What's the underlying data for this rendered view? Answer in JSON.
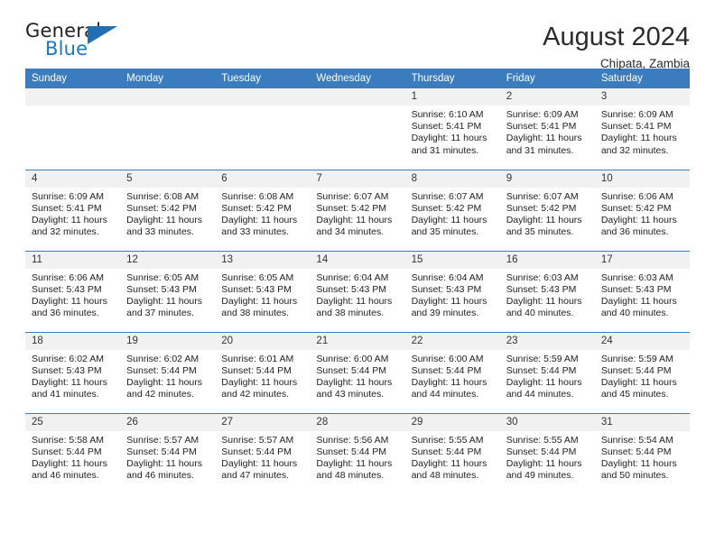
{
  "logo": {
    "word_top": "General",
    "word_bottom": "Blue",
    "triangle_color": "#1f6fb4",
    "blue_color": "#1a78c2"
  },
  "header": {
    "title": "August 2024",
    "subtitle": "Chipata, Zambia"
  },
  "theme": {
    "header_blue": "#3a7cbe",
    "daynum_band": "#f1f1f1",
    "text": "#212121"
  },
  "weekdays": [
    "Sunday",
    "Monday",
    "Tuesday",
    "Wednesday",
    "Thursday",
    "Friday",
    "Saturday"
  ],
  "weeks": [
    [
      {
        "day": "",
        "sunrise": "",
        "sunset": "",
        "daylight1": "",
        "daylight2": "",
        "empty": true
      },
      {
        "day": "",
        "sunrise": "",
        "sunset": "",
        "daylight1": "",
        "daylight2": "",
        "empty": true
      },
      {
        "day": "",
        "sunrise": "",
        "sunset": "",
        "daylight1": "",
        "daylight2": "",
        "empty": true
      },
      {
        "day": "",
        "sunrise": "",
        "sunset": "",
        "daylight1": "",
        "daylight2": "",
        "empty": true
      },
      {
        "day": "1",
        "sunrise": "Sunrise: 6:10 AM",
        "sunset": "Sunset: 5:41 PM",
        "daylight1": "Daylight: 11 hours",
        "daylight2": "and 31 minutes.",
        "empty": false
      },
      {
        "day": "2",
        "sunrise": "Sunrise: 6:09 AM",
        "sunset": "Sunset: 5:41 PM",
        "daylight1": "Daylight: 11 hours",
        "daylight2": "and 31 minutes.",
        "empty": false
      },
      {
        "day": "3",
        "sunrise": "Sunrise: 6:09 AM",
        "sunset": "Sunset: 5:41 PM",
        "daylight1": "Daylight: 11 hours",
        "daylight2": "and 32 minutes.",
        "empty": false
      }
    ],
    [
      {
        "day": "4",
        "sunrise": "Sunrise: 6:09 AM",
        "sunset": "Sunset: 5:41 PM",
        "daylight1": "Daylight: 11 hours",
        "daylight2": "and 32 minutes.",
        "empty": false
      },
      {
        "day": "5",
        "sunrise": "Sunrise: 6:08 AM",
        "sunset": "Sunset: 5:42 PM",
        "daylight1": "Daylight: 11 hours",
        "daylight2": "and 33 minutes.",
        "empty": false
      },
      {
        "day": "6",
        "sunrise": "Sunrise: 6:08 AM",
        "sunset": "Sunset: 5:42 PM",
        "daylight1": "Daylight: 11 hours",
        "daylight2": "and 33 minutes.",
        "empty": false
      },
      {
        "day": "7",
        "sunrise": "Sunrise: 6:07 AM",
        "sunset": "Sunset: 5:42 PM",
        "daylight1": "Daylight: 11 hours",
        "daylight2": "and 34 minutes.",
        "empty": false
      },
      {
        "day": "8",
        "sunrise": "Sunrise: 6:07 AM",
        "sunset": "Sunset: 5:42 PM",
        "daylight1": "Daylight: 11 hours",
        "daylight2": "and 35 minutes.",
        "empty": false
      },
      {
        "day": "9",
        "sunrise": "Sunrise: 6:07 AM",
        "sunset": "Sunset: 5:42 PM",
        "daylight1": "Daylight: 11 hours",
        "daylight2": "and 35 minutes.",
        "empty": false
      },
      {
        "day": "10",
        "sunrise": "Sunrise: 6:06 AM",
        "sunset": "Sunset: 5:42 PM",
        "daylight1": "Daylight: 11 hours",
        "daylight2": "and 36 minutes.",
        "empty": false
      }
    ],
    [
      {
        "day": "11",
        "sunrise": "Sunrise: 6:06 AM",
        "sunset": "Sunset: 5:43 PM",
        "daylight1": "Daylight: 11 hours",
        "daylight2": "and 36 minutes.",
        "empty": false
      },
      {
        "day": "12",
        "sunrise": "Sunrise: 6:05 AM",
        "sunset": "Sunset: 5:43 PM",
        "daylight1": "Daylight: 11 hours",
        "daylight2": "and 37 minutes.",
        "empty": false
      },
      {
        "day": "13",
        "sunrise": "Sunrise: 6:05 AM",
        "sunset": "Sunset: 5:43 PM",
        "daylight1": "Daylight: 11 hours",
        "daylight2": "and 38 minutes.",
        "empty": false
      },
      {
        "day": "14",
        "sunrise": "Sunrise: 6:04 AM",
        "sunset": "Sunset: 5:43 PM",
        "daylight1": "Daylight: 11 hours",
        "daylight2": "and 38 minutes.",
        "empty": false
      },
      {
        "day": "15",
        "sunrise": "Sunrise: 6:04 AM",
        "sunset": "Sunset: 5:43 PM",
        "daylight1": "Daylight: 11 hours",
        "daylight2": "and 39 minutes.",
        "empty": false
      },
      {
        "day": "16",
        "sunrise": "Sunrise: 6:03 AM",
        "sunset": "Sunset: 5:43 PM",
        "daylight1": "Daylight: 11 hours",
        "daylight2": "and 40 minutes.",
        "empty": false
      },
      {
        "day": "17",
        "sunrise": "Sunrise: 6:03 AM",
        "sunset": "Sunset: 5:43 PM",
        "daylight1": "Daylight: 11 hours",
        "daylight2": "and 40 minutes.",
        "empty": false
      }
    ],
    [
      {
        "day": "18",
        "sunrise": "Sunrise: 6:02 AM",
        "sunset": "Sunset: 5:43 PM",
        "daylight1": "Daylight: 11 hours",
        "daylight2": "and 41 minutes.",
        "empty": false
      },
      {
        "day": "19",
        "sunrise": "Sunrise: 6:02 AM",
        "sunset": "Sunset: 5:44 PM",
        "daylight1": "Daylight: 11 hours",
        "daylight2": "and 42 minutes.",
        "empty": false
      },
      {
        "day": "20",
        "sunrise": "Sunrise: 6:01 AM",
        "sunset": "Sunset: 5:44 PM",
        "daylight1": "Daylight: 11 hours",
        "daylight2": "and 42 minutes.",
        "empty": false
      },
      {
        "day": "21",
        "sunrise": "Sunrise: 6:00 AM",
        "sunset": "Sunset: 5:44 PM",
        "daylight1": "Daylight: 11 hours",
        "daylight2": "and 43 minutes.",
        "empty": false
      },
      {
        "day": "22",
        "sunrise": "Sunrise: 6:00 AM",
        "sunset": "Sunset: 5:44 PM",
        "daylight1": "Daylight: 11 hours",
        "daylight2": "and 44 minutes.",
        "empty": false
      },
      {
        "day": "23",
        "sunrise": "Sunrise: 5:59 AM",
        "sunset": "Sunset: 5:44 PM",
        "daylight1": "Daylight: 11 hours",
        "daylight2": "and 44 minutes.",
        "empty": false
      },
      {
        "day": "24",
        "sunrise": "Sunrise: 5:59 AM",
        "sunset": "Sunset: 5:44 PM",
        "daylight1": "Daylight: 11 hours",
        "daylight2": "and 45 minutes.",
        "empty": false
      }
    ],
    [
      {
        "day": "25",
        "sunrise": "Sunrise: 5:58 AM",
        "sunset": "Sunset: 5:44 PM",
        "daylight1": "Daylight: 11 hours",
        "daylight2": "and 46 minutes.",
        "empty": false
      },
      {
        "day": "26",
        "sunrise": "Sunrise: 5:57 AM",
        "sunset": "Sunset: 5:44 PM",
        "daylight1": "Daylight: 11 hours",
        "daylight2": "and 46 minutes.",
        "empty": false
      },
      {
        "day": "27",
        "sunrise": "Sunrise: 5:57 AM",
        "sunset": "Sunset: 5:44 PM",
        "daylight1": "Daylight: 11 hours",
        "daylight2": "and 47 minutes.",
        "empty": false
      },
      {
        "day": "28",
        "sunrise": "Sunrise: 5:56 AM",
        "sunset": "Sunset: 5:44 PM",
        "daylight1": "Daylight: 11 hours",
        "daylight2": "and 48 minutes.",
        "empty": false
      },
      {
        "day": "29",
        "sunrise": "Sunrise: 5:55 AM",
        "sunset": "Sunset: 5:44 PM",
        "daylight1": "Daylight: 11 hours",
        "daylight2": "and 48 minutes.",
        "empty": false
      },
      {
        "day": "30",
        "sunrise": "Sunrise: 5:55 AM",
        "sunset": "Sunset: 5:44 PM",
        "daylight1": "Daylight: 11 hours",
        "daylight2": "and 49 minutes.",
        "empty": false
      },
      {
        "day": "31",
        "sunrise": "Sunrise: 5:54 AM",
        "sunset": "Sunset: 5:44 PM",
        "daylight1": "Daylight: 11 hours",
        "daylight2": "and 50 minutes.",
        "empty": false
      }
    ]
  ]
}
